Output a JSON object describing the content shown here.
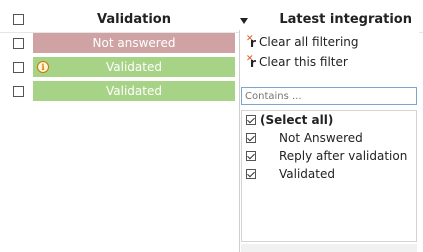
{
  "header": {
    "validation_label": "Validation",
    "latest_integration_label": "Latest integration"
  },
  "rows": [
    {
      "status": "Not answered",
      "color": "#cfa3a3",
      "has_info_icon": false
    },
    {
      "status": "Validated",
      "color": "#a7d387",
      "has_info_icon": true
    },
    {
      "status": "Validated",
      "color": "#a7d387",
      "has_info_icon": false
    }
  ],
  "filter": {
    "clear_all_label": "Clear all filtering",
    "clear_this_label": "Clear this filter",
    "search_placeholder": "Contains ...",
    "options": [
      {
        "label": "(Select all)",
        "checked": true
      },
      {
        "label": "Not Answered",
        "checked": true
      },
      {
        "label": "Reply after validation",
        "checked": true
      },
      {
        "label": "Validated",
        "checked": true
      }
    ]
  },
  "colors": {
    "not_answered": "#cfa3a3",
    "validated": "#a7d387",
    "clear_icon": "#d9531e"
  },
  "icons": {
    "info": "info-icon",
    "clear_filter": "clear-filter-icon"
  }
}
